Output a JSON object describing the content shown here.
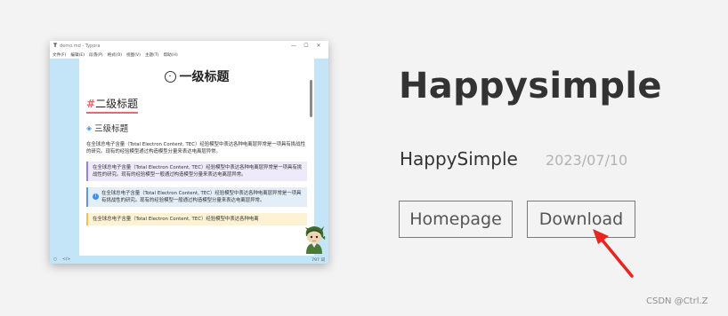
{
  "theme": {
    "title": "Happysimple",
    "author": "HappySimple",
    "date": "2023/07/10"
  },
  "buttons": {
    "homepage_label": "Homepage",
    "download_label": "Download"
  },
  "watermark": "CSDN @Ctrl.Z",
  "preview": {
    "window": {
      "app_icon": "T",
      "title": "demo.md - Typora",
      "controls": [
        "—",
        "☐",
        "✕"
      ],
      "menu": [
        "文件(F)",
        "编辑(E)",
        "段落(P)",
        "格式(O)",
        "视图(V)",
        "主题(T)",
        "帮助(H)"
      ]
    },
    "doc": {
      "h1": "一级标题",
      "h2_hash": "#",
      "h2": "二级标题",
      "h3": "三级标题",
      "paragraph": "在全球总电子含量（Total Electron Content, TEC）经验模型中表达各种电离层异常是一项具有挑战性的研究。现有的经验模型通过构造模型分量来表达电离层异常。",
      "callout_purple": "在全球总电子含量（Total Electron Content, TEC）经验模型中表达各种电离层异常是一项具有挑战性的研究。现有的经验模型一般通过构造模型分量来表达电离层异常。",
      "callout_blue": "在全球总电子含量（Total Electron Content, TEC）经验模型中表达各种电离层异常是一项具有挑战性的研究。现有的经验模型一般通过构造模型分量来表达电离层异常。",
      "callout_yellow": "在全球总电子含量（Total Electron Content, TEC）经验模型中表达各种电离"
    },
    "statusbar": {
      "left_icon": "○",
      "code_icon": "</>",
      "word_count": "797 词"
    }
  },
  "colors": {
    "page_bg": "#f3f3f3",
    "preview_sidebar": "#c4e4f7",
    "heading_accent": "#e06c6c",
    "annotation_arrow": "#e8261f"
  }
}
